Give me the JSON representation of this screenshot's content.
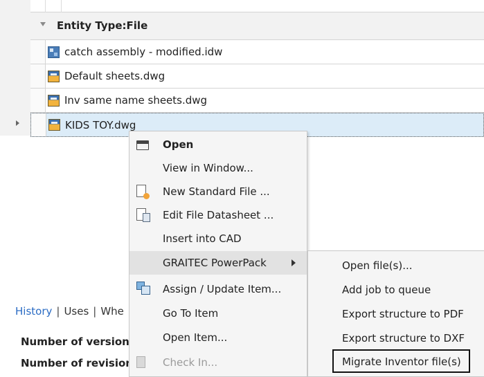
{
  "grid": {
    "group_label": "Entity Type:File",
    "rows": [
      {
        "name": "catch assembly - modified.idw",
        "icon": "idw-file-icon"
      },
      {
        "name": "Default sheets.dwg",
        "icon": "dwg-file-icon"
      },
      {
        "name": "Inv same name sheets.dwg",
        "icon": "dwg-file-icon"
      },
      {
        "name": "KIDS TOY.dwg",
        "icon": "dwg-file-icon",
        "selected": true
      }
    ]
  },
  "bottom_panel": {
    "tabs": [
      "History",
      "Uses",
      "Whe"
    ],
    "properties": [
      "Number of versions",
      "Number of revision"
    ]
  },
  "context_menu": {
    "items": [
      {
        "label": "Open",
        "icon": "folder-open-icon",
        "bold": true
      },
      {
        "label": "View in Window..."
      },
      {
        "label": "New Standard File ...",
        "icon": "new-file-icon"
      },
      {
        "label": "Edit File Datasheet ...",
        "icon": "datasheet-icon"
      },
      {
        "label": "Insert into CAD"
      },
      {
        "label": "GRAITEC PowerPack",
        "submenu": true,
        "highlighted": true
      },
      {
        "label": "Assign / Update Item...",
        "icon": "assign-item-icon"
      },
      {
        "label": "Go To Item"
      },
      {
        "label": "Open Item..."
      },
      {
        "label": "Check In...",
        "icon": "check-in-icon",
        "disabled": true
      }
    ]
  },
  "submenu": {
    "items": [
      {
        "label": "Open file(s)..."
      },
      {
        "label": "Add job to queue"
      },
      {
        "label": "Export structure to PDF"
      },
      {
        "label": "Export structure to DXF"
      },
      {
        "label": "Migrate Inventor file(s)",
        "boxed": true
      }
    ]
  },
  "colors": {
    "selection": "#dcecf8",
    "link": "#2b6cc4",
    "menu_bg": "#f5f5f5",
    "menu_highlight": "#e2e2e2"
  }
}
